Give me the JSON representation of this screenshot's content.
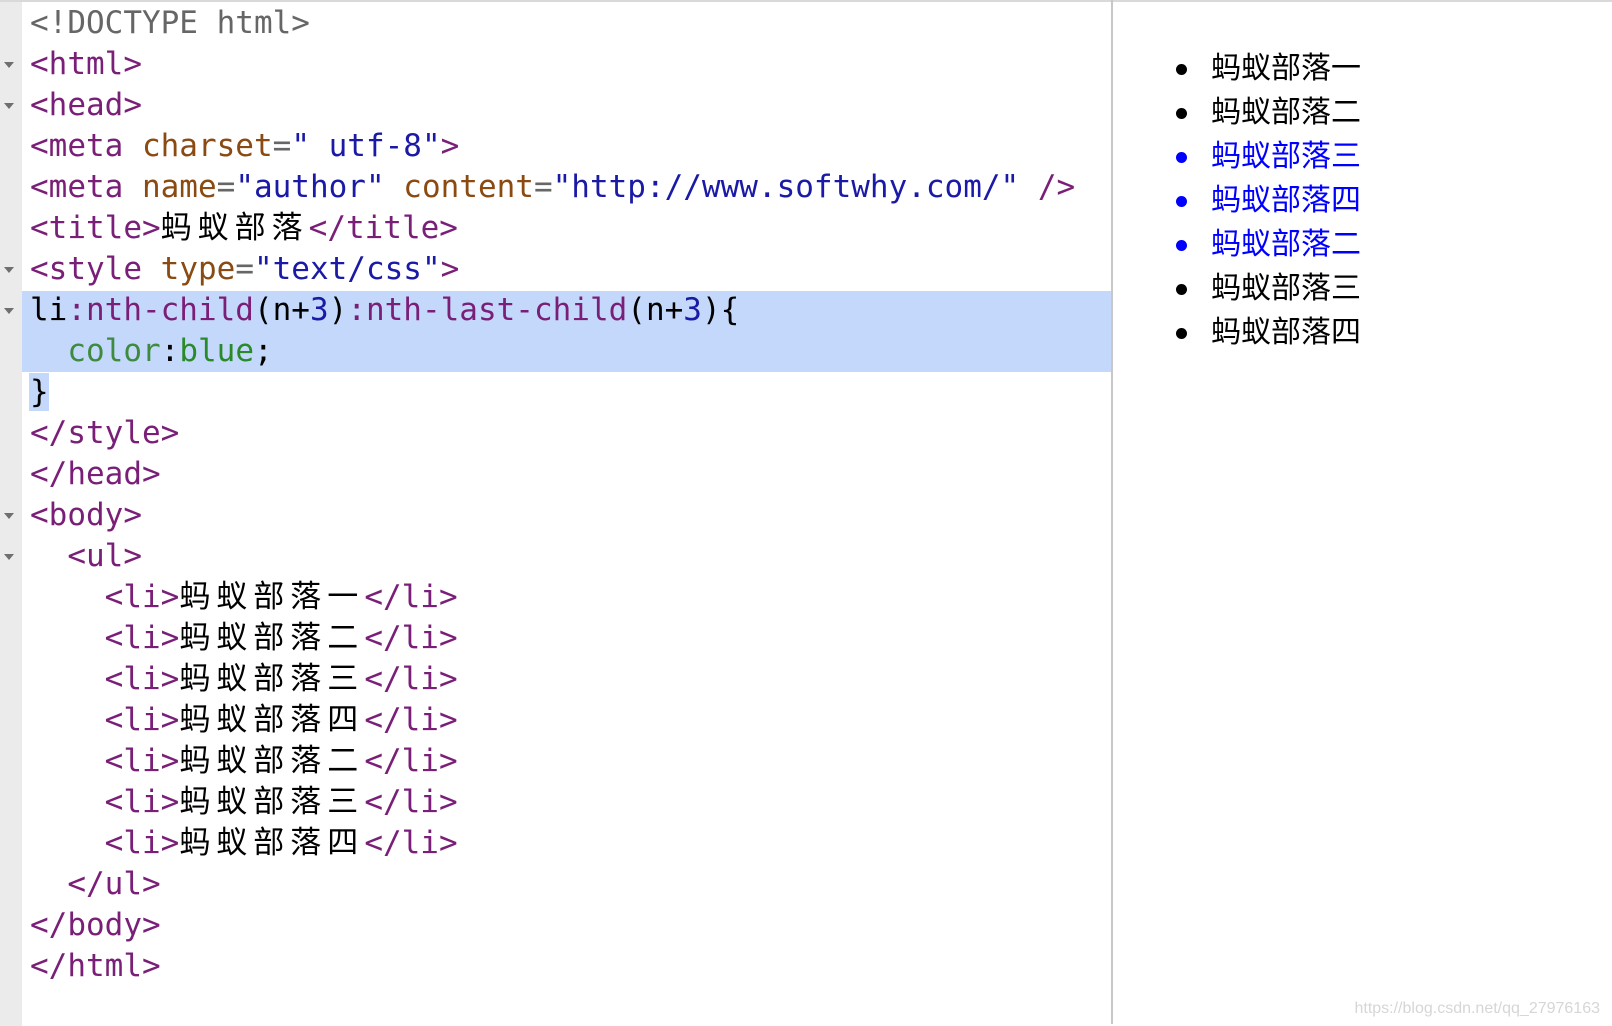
{
  "editor": {
    "lines": [
      [
        [
          "t-doc",
          "<!DOCTYPE html>"
        ]
      ],
      [
        [
          "t-tag",
          "<html>"
        ]
      ],
      [
        [
          "t-tag",
          "<head>"
        ]
      ],
      [
        [
          "t-tag",
          "<meta "
        ],
        [
          "t-attr",
          "charset"
        ],
        [
          "t-doc",
          "="
        ],
        [
          "t-val",
          "\" utf-8\""
        ],
        [
          "t-tag",
          ">"
        ]
      ],
      [
        [
          "t-tag",
          "<meta "
        ],
        [
          "t-attr",
          "name"
        ],
        [
          "t-doc",
          "="
        ],
        [
          "t-val",
          "\"author\" "
        ],
        [
          "t-attr",
          "content"
        ],
        [
          "t-doc",
          "="
        ],
        [
          "t-val",
          "\"http://www.softwhy.com/\" "
        ],
        [
          "t-tag",
          "/>"
        ]
      ],
      [
        [
          "t-tag",
          "<title>"
        ],
        [
          "t-txt cjk",
          "蚂蚁部落"
        ],
        [
          "t-tag",
          "</title>"
        ]
      ],
      [
        [
          "t-tag",
          "<style "
        ],
        [
          "t-attr",
          "type"
        ],
        [
          "t-doc",
          "="
        ],
        [
          "t-val",
          "\"text/css\""
        ],
        [
          "t-tag",
          ">"
        ]
      ],
      [
        [
          "t-txt",
          "li"
        ],
        [
          "t-sel",
          ":nth-child"
        ],
        [
          "t-txt",
          "(n+"
        ],
        [
          "t-num",
          "3"
        ],
        [
          "t-txt",
          ")"
        ],
        [
          "t-sel",
          ":nth-last-child"
        ],
        [
          "t-txt",
          "(n+"
        ],
        [
          "t-num",
          "3"
        ],
        [
          "t-txt",
          "){"
        ]
      ],
      [
        [
          "t-txt",
          "  "
        ],
        [
          "t-prop",
          "color"
        ],
        [
          "t-txt",
          ":"
        ],
        [
          "t-pval",
          "blue"
        ],
        [
          "t-txt",
          ";"
        ]
      ],
      [
        [
          "t-txt",
          "}"
        ]
      ],
      [
        [
          "t-tag",
          "</style>"
        ]
      ],
      [
        [
          "t-tag",
          "</head>"
        ]
      ],
      [
        [
          "t-tag",
          "<body>"
        ]
      ],
      [
        [
          "t-txt",
          "  "
        ],
        [
          "t-tag",
          "<ul>"
        ]
      ],
      [
        [
          "t-txt",
          "    "
        ],
        [
          "t-tag",
          "<li>"
        ],
        [
          "t-txt cjk",
          "蚂蚁部落一"
        ],
        [
          "t-tag",
          "</li>"
        ]
      ],
      [
        [
          "t-txt",
          "    "
        ],
        [
          "t-tag",
          "<li>"
        ],
        [
          "t-txt cjk",
          "蚂蚁部落二"
        ],
        [
          "t-tag",
          "</li>"
        ]
      ],
      [
        [
          "t-txt",
          "    "
        ],
        [
          "t-tag",
          "<li>"
        ],
        [
          "t-txt cjk",
          "蚂蚁部落三"
        ],
        [
          "t-tag",
          "</li>"
        ]
      ],
      [
        [
          "t-txt",
          "    "
        ],
        [
          "t-tag",
          "<li>"
        ],
        [
          "t-txt cjk",
          "蚂蚁部落四"
        ],
        [
          "t-tag",
          "</li>"
        ]
      ],
      [
        [
          "t-txt",
          "    "
        ],
        [
          "t-tag",
          "<li>"
        ],
        [
          "t-txt cjk",
          "蚂蚁部落二"
        ],
        [
          "t-tag",
          "</li>"
        ]
      ],
      [
        [
          "t-txt",
          "    "
        ],
        [
          "t-tag",
          "<li>"
        ],
        [
          "t-txt cjk",
          "蚂蚁部落三"
        ],
        [
          "t-tag",
          "</li>"
        ]
      ],
      [
        [
          "t-txt",
          "    "
        ],
        [
          "t-tag",
          "<li>"
        ],
        [
          "t-txt cjk",
          "蚂蚁部落四"
        ],
        [
          "t-tag",
          "</li>"
        ]
      ],
      [
        [
          "t-txt",
          "  "
        ],
        [
          "t-tag",
          "</ul>"
        ]
      ],
      [
        [
          "t-tag",
          "</body>"
        ]
      ],
      [
        [
          "t-tag",
          "</html>"
        ]
      ]
    ],
    "fold_icon": "fold-triangle-icon"
  },
  "preview": {
    "items": [
      {
        "label": "蚂蚁部落一",
        "color": "#000000"
      },
      {
        "label": "蚂蚁部落二",
        "color": "#000000"
      },
      {
        "label": "蚂蚁部落三",
        "color": "#0000ff"
      },
      {
        "label": "蚂蚁部落四",
        "color": "#0000ff"
      },
      {
        "label": "蚂蚁部落二",
        "color": "#0000ff"
      },
      {
        "label": "蚂蚁部落三",
        "color": "#000000"
      },
      {
        "label": "蚂蚁部落四",
        "color": "#000000"
      }
    ]
  },
  "watermark": "https://blog.csdn.net/qq_27976163"
}
